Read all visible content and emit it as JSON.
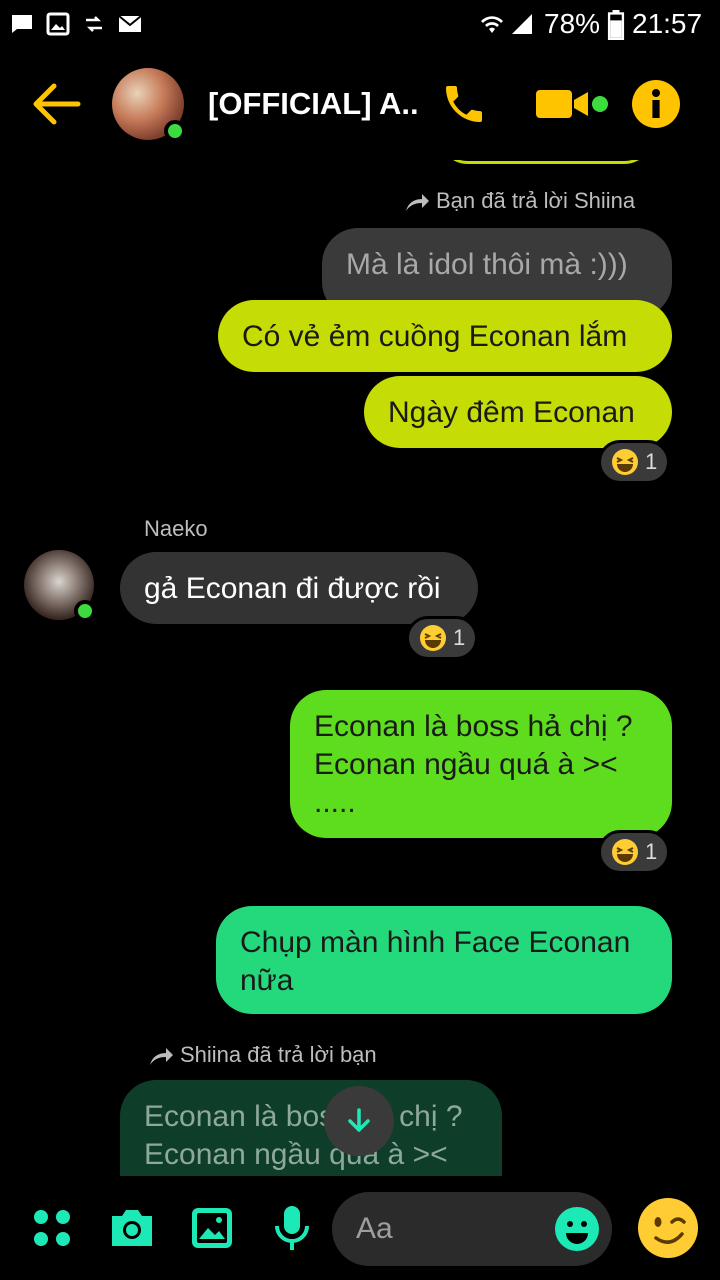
{
  "status_bar": {
    "battery": "78%",
    "time": "21:57"
  },
  "header": {
    "title": "[OFFICIAL] A...",
    "accent_color": "#FFC400"
  },
  "messages": {
    "reply_note_1": "Bạn đã trả lời Shiina",
    "quoted_1": "Mà là idol thôi mà :)))",
    "m1": "Có vẻ ẻm cuồng Econan lắm",
    "m2": "Ngày đêm Econan",
    "m2_reaction_count": "1",
    "sender_naeko": "Naeko",
    "m3": "gả Econan đi được rồi",
    "m3_reaction_count": "1",
    "m4_line1": "Econan là boss hả chị ?",
    "m4_line2": "Econan ngầu quá à ><",
    "m4_line3": ".....",
    "m4_reaction_count": "1",
    "m5_line1": "Chụp màn hình Face Econan",
    "m5_line2": "nữa",
    "reply_note_2": "Shiina đã trả lời bạn",
    "quoted_2_line1": "Econan là boss hả chị ?",
    "quoted_2_line2": "Econan ngầu quá à ><"
  },
  "composer": {
    "placeholder": "Aa"
  },
  "colors": {
    "bubble_yellowgreen": "#C5DC05",
    "bubble_green": "#5EDC1E",
    "bubble_teal": "#24D97C",
    "bubble_dark": "#333333",
    "quoted_dark": "#3A3A3A",
    "quoted_teal_dark": "#0E3D2A",
    "icon_teal": "#1DE9B6"
  }
}
